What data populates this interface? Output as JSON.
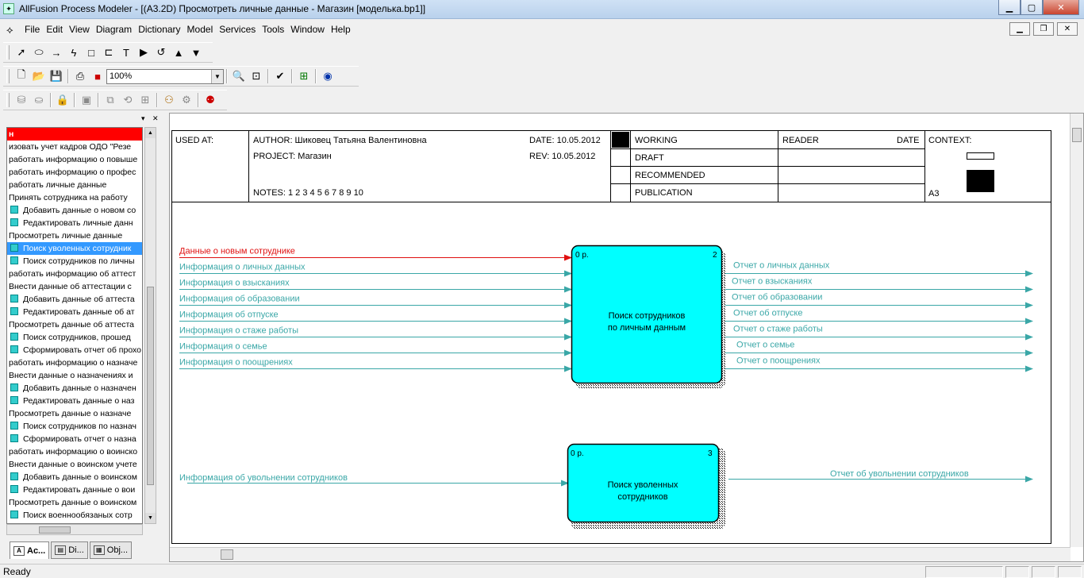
{
  "window": {
    "title": "AllFusion Process Modeler - [(A3.2D) Просмотреть  личные данные - Магазин  [моделька.bp1]]"
  },
  "menu": [
    "File",
    "Edit",
    "View",
    "Diagram",
    "Dictionary",
    "Model",
    "Services",
    "Tools",
    "Window",
    "Help"
  ],
  "toolbar": {
    "zoom": "100%"
  },
  "tree": [
    {
      "text": "н",
      "style": "red"
    },
    {
      "text": "изовать учет кадров ОДО  \"Резе",
      "style": ""
    },
    {
      "text": "работать информацию  о повыше",
      "style": ""
    },
    {
      "text": "работать информацию  о профес",
      "style": ""
    },
    {
      "text": "работать  личные данные",
      "style": ""
    },
    {
      "text": "Принять сотрудника  на работу",
      "style": ""
    },
    {
      "text": "Добавить данные о  новом со",
      "style": "icon"
    },
    {
      "text": "Редактировать  личные данн",
      "style": "icon"
    },
    {
      "text": "Просмотреть  личные данные",
      "style": ""
    },
    {
      "text": "Поиск уволенных  сотрудник",
      "style": "sel"
    },
    {
      "text": "Поиск сотрудников  по личны",
      "style": "icon"
    },
    {
      "text": "работать информацию  об аттест",
      "style": ""
    },
    {
      "text": "Внести данные  об аттестации с",
      "style": ""
    },
    {
      "text": "Добавить данные об аттеста",
      "style": "icon"
    },
    {
      "text": "Редактировать  данные  об ат",
      "style": "icon"
    },
    {
      "text": "Просмотреть данные  об аттеста",
      "style": ""
    },
    {
      "text": "Поиск сотрудников,  прошед",
      "style": "icon"
    },
    {
      "text": "Сформировать отчет об прохо",
      "style": "icon"
    },
    {
      "text": "работать информацию о назначе",
      "style": ""
    },
    {
      "text": "Внести данные  о назначениях и",
      "style": ""
    },
    {
      "text": "Добавить данные о назначен",
      "style": "icon"
    },
    {
      "text": "Редактировать данные  о наз",
      "style": "icon"
    },
    {
      "text": "Просмотреть данные о назначе",
      "style": ""
    },
    {
      "text": "Поиск сотрудников по назнач",
      "style": "icon"
    },
    {
      "text": "Сформировать отчет о назна",
      "style": "icon"
    },
    {
      "text": "работать информацию о воинско",
      "style": ""
    },
    {
      "text": "Внести данные о воинском учете",
      "style": ""
    },
    {
      "text": "Добавить данные о воинском",
      "style": "icon"
    },
    {
      "text": "Редактировать данные о  вои",
      "style": "icon"
    },
    {
      "text": "Просмотреть данные о воинском",
      "style": ""
    },
    {
      "text": "Поиск военнообязаных  сотр",
      "style": "icon"
    }
  ],
  "tabs": [
    "Ac...",
    "Di...",
    "Obj..."
  ],
  "frame": {
    "used_at": "USED AT:",
    "author": "AUTHOR:  Шиковец Татьяна Валентиновна",
    "project": "PROJECT:  Магазин",
    "date": "DATE:  10.05.2012",
    "rev": "REV:    10.05.2012",
    "notes": "NOTES:  1  2  3  4  5  6  7  8  9  10",
    "status": [
      "WORKING",
      "DRAFT",
      "RECOMMENDED",
      "PUBLICATION"
    ],
    "reader": "READER",
    "reader_date": "DATE",
    "context": "CONTEXT:",
    "node": "A3"
  },
  "box1": {
    "label1": "Поиск сотрудников",
    "label2": "по личным данным",
    "cost": "0 р.",
    "num": "2"
  },
  "box2": {
    "label1": "Поиск уволенных",
    "label2": "сотрудников",
    "cost": "0 р.",
    "num": "3"
  },
  "inputs1": [
    "Данные о новым сотруднике",
    "Информация о личных данных",
    "Информация о взысканиях",
    "Информация об образовании",
    "Информация об отпуске",
    "Информация о стаже работы",
    "Информация о семье",
    "Информация о поощрениях"
  ],
  "outputs1": [
    "Отчет о личных данных",
    "Отчет о взысканиях",
    "Отчет об образовании",
    "Отчет об отпуске",
    "Отчет о стаже работы",
    "Отчет о семье",
    "Отчет о поощрениях"
  ],
  "input2": "Информация об увольнении сотрудников",
  "output2": "Отчет об увольнении сотрудников",
  "colors": {
    "arrow": "#3aa7a7",
    "box": "#00ffff",
    "control": "#e01010"
  },
  "status_text": "Ready"
}
